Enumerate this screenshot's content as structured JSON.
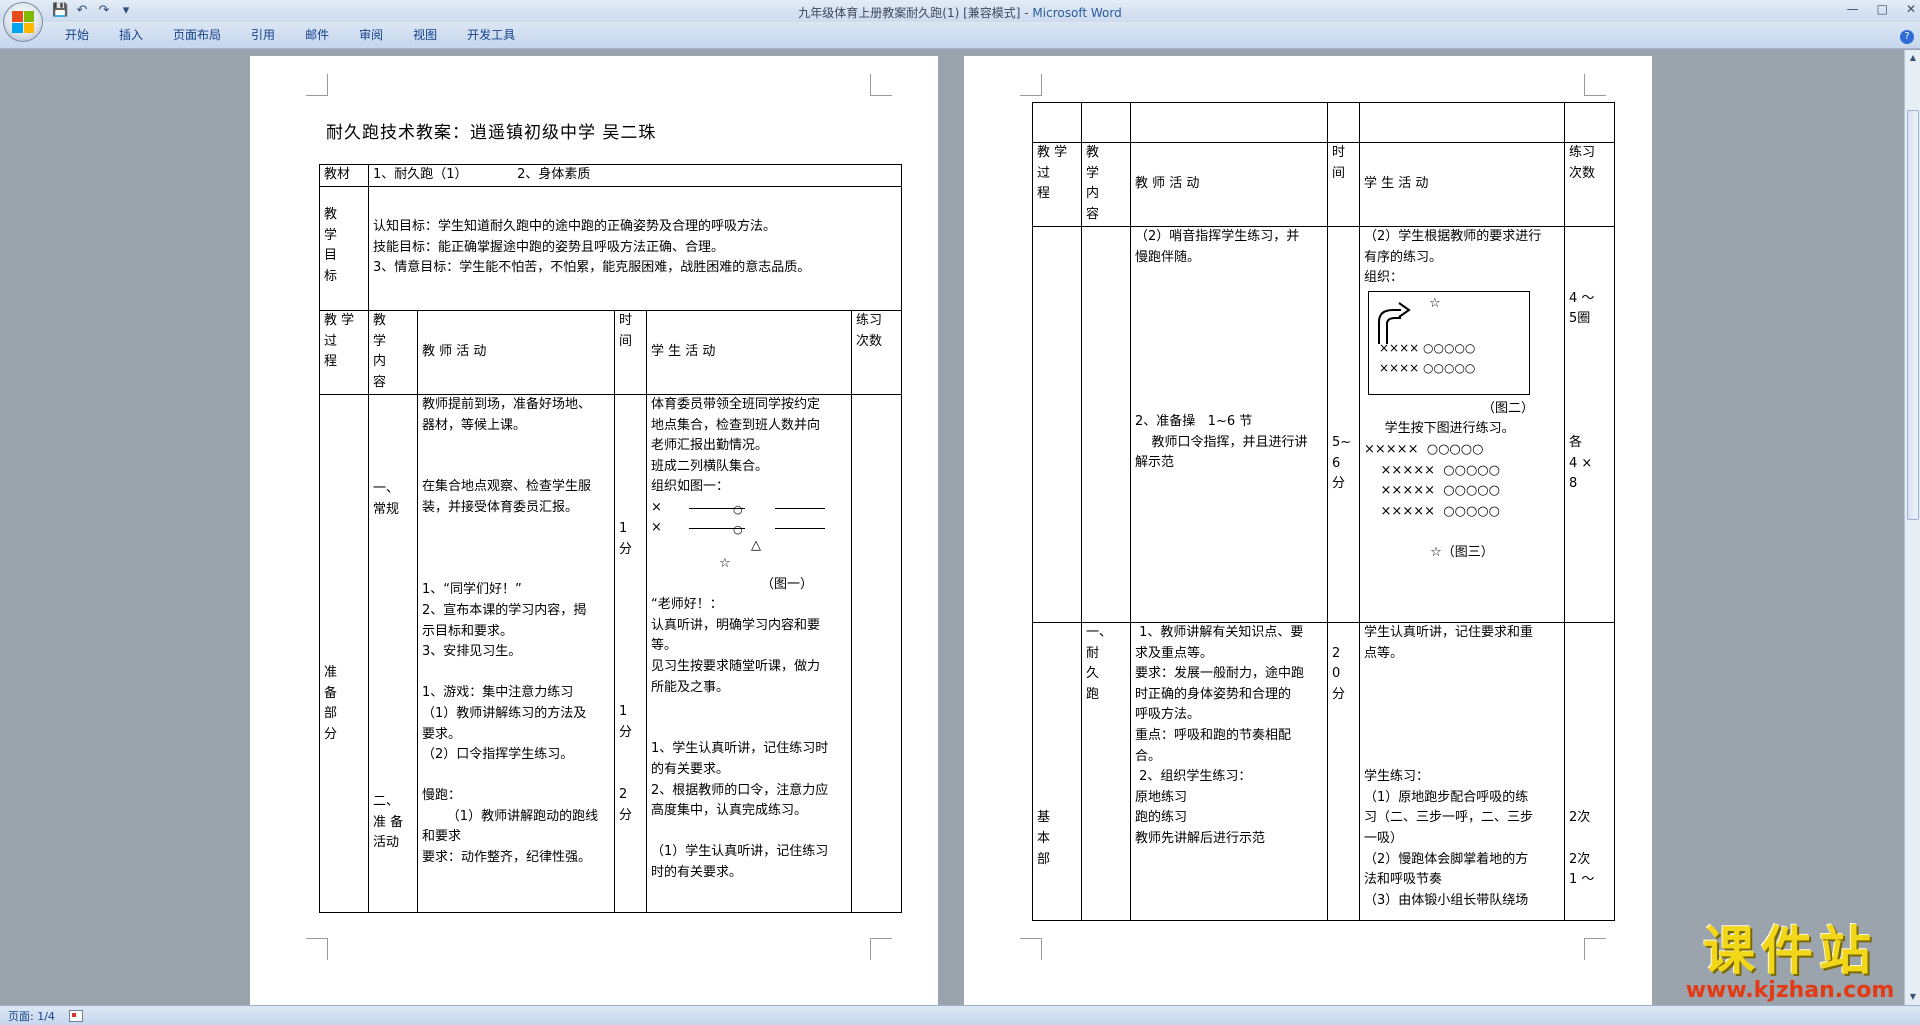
{
  "window": {
    "title": "九年级体育上册教案耐久跑(1) [兼容模式] - ",
    "app_name": "Microsoft Word",
    "quick_access": [
      "save-icon",
      "undo-icon",
      "redo-icon",
      "customize-icon"
    ],
    "controls": [
      "minimize-icon",
      "maximize-icon",
      "close-icon"
    ]
  },
  "ribbon": {
    "tabs": [
      "开始",
      "插入",
      "页面布局",
      "引用",
      "邮件",
      "审阅",
      "视图",
      "开发工具"
    ]
  },
  "statusbar": {
    "page": "页面: 1/4"
  },
  "watermark": {
    "main": "课件站",
    "url": "www.kjzhan.com"
  },
  "page1": {
    "title": "耐久跑技术教案：逍遥镇初级中学      吴二珠",
    "row_material": {
      "label": "教材",
      "content": "1、耐久跑（1）            2、身体素质"
    },
    "row_goal": {
      "label": "教\n学\n目\n标",
      "lines": [
        "认知目标：学生知道耐久跑中的途中跑的正确姿势及合理的呼吸方法。",
        "技能目标：能正确掌握途中跑的姿势且呼吸方法正确、合理。",
        "3、情意目标：学生能不怕苦，不怕累，能克服困难，战胜困难的意志品质。"
      ]
    },
    "header": {
      "process": "教 学\n过\n程",
      "content": "教\n学\n内\n容",
      "teacher": "教 师 活 动",
      "time": "时\n间",
      "student": "学 生 活 动",
      "practice": "练习\n次数"
    },
    "body": {
      "process": "准\n备\n部\n分",
      "content_a": "一、\n常规",
      "content_b": "二、\n准 备\n活动",
      "teacher_lines": [
        "教师提前到场，准备好场地、",
        "器材，等候上课。",
        "",
        "",
        "在集合地点观察、检查学生服",
        "装，并接受体育委员汇报。",
        "",
        "",
        "",
        "1、“同学们好！”",
        "2、宣布本课的学习内容，揭",
        "示目标和要求。",
        "3、安排见习生。",
        "",
        "1、游戏：集中注意力练习",
        "（1）教师讲解练习的方法及",
        "要求。",
        "（2）口令指挥学生练习。",
        "",
        "慢跑：",
        "      （1）教师讲解跑动的跑线",
        "和要求",
        "要求：动作整齐，纪律性强。"
      ],
      "time_1": "1\n分",
      "time_2": "1\n分",
      "time_3": "2\n分",
      "student_lines_a": [
        "体育委员带领全班同学按约定",
        "地点集合，检查到班人数并向",
        "老师汇报出勤情况。",
        "班成二列横队集合。",
        "组织如图一："
      ],
      "fig1_rows": [
        "×",
        "×"
      ],
      "fig1_triangle": "△",
      "fig1_star": "☆",
      "fig1_caption": "（图一）",
      "student_lines_b": [
        "“老师好！：",
        "认真听讲，明确学习内容和要",
        "等。",
        "见习生按要求随堂听课，做力",
        "所能及之事。",
        "",
        "",
        "1、学生认真听讲，记住练习时",
        "的有关要求。",
        "2、根据教师的口令，注意力应",
        "高度集中，认真完成练习。",
        "",
        "（1）学生认真听讲，记住练习",
        "时的有关要求。"
      ]
    }
  },
  "page2": {
    "header": {
      "process": "教 学\n过\n程",
      "content": "教\n学\n内\n容",
      "teacher": "教 师 活 动",
      "time": "时\n间",
      "student": "学 生 活 动",
      "practice": "练习\n次数"
    },
    "row1": {
      "teacher_lines": [
        "（2）哨音指挥学生练习，并",
        "慢跑伴随。",
        "",
        "",
        "",
        "",
        "",
        "",
        "",
        "2、准备操   1~6 节",
        "    教师口令指挥，并且进行讲",
        "解示范"
      ],
      "time": "\n\n\n\n\n\n\n\n\n\n5~\n6\n分",
      "student_lines_a": [
        "（2）学生根据教师的要求进行",
        "有序的练习。",
        "组织："
      ],
      "fig2_star": "☆",
      "fig2_rows": [
        "×××× ○○○○○",
        "×××× ○○○○○"
      ],
      "fig2_caption": "（图二）",
      "student_lines_b": [
        "     学生按下图进行练习。",
        "×××××  ○○○○○",
        "    ×××××  ○○○○○",
        "    ×××××  ○○○○○",
        "    ×××××  ○○○○○",
        "",
        "                ☆（图三）"
      ],
      "practice": "\n\n\n4 ～\n5圈\n\n\n\n\n\n各\n4 ×\n8"
    },
    "row2": {
      "process": "\n\n\n\n\n\n\n\n\n基\n本\n部",
      "content": "一、\n耐\n久\n跑",
      "teacher_lines": [
        " 1、教师讲解有关知识点、要",
        "求及重点等。",
        "要求：发展一般耐力，途中跑",
        "时正确的身体姿势和合理的",
        "呼吸方法。",
        "重点：呼吸和跑的节奏相配",
        "合。",
        " 2、组织学生练习：",
        "原地练习",
        "跑的练习",
        "教师先讲解后进行示范"
      ],
      "time": "\n2\n0\n分",
      "student_lines": [
        "学生认真听讲，记住要求和重",
        "点等。",
        "",
        "",
        "",
        "",
        "",
        "学生练习：",
        "（1）原地跑步配合呼吸的练",
        "习（二、三步一呼，二、三步",
        "一吸）",
        "（2）慢跑体会脚掌着地的方",
        "法和呼吸节奏",
        "（3）由体锻小组长带队绕场"
      ],
      "practice": "\n\n\n\n\n\n\n\n\n2次\n\n2次\n1 ～"
    }
  }
}
